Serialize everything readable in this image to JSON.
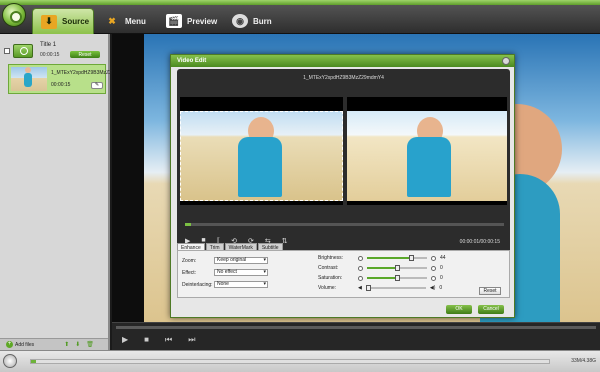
{
  "app": {
    "title_strip": ""
  },
  "tabs": [
    {
      "label": "Source",
      "icon": "source-icon"
    },
    {
      "label": "Menu",
      "icon": "menu-icon"
    },
    {
      "label": "Preview",
      "icon": "preview-icon"
    },
    {
      "label": "Burn",
      "icon": "burn-icon"
    }
  ],
  "sidebar": {
    "title": "Title 1",
    "title_time": "00:00:15",
    "reset_label": "Reset",
    "clip_name": "1_MTExY2xpdHZ9B3MzZ29mdmY4",
    "clip_time": "00:00:15",
    "add_files": "Add files"
  },
  "dialog": {
    "title": "Video Edit",
    "filename": "1_MTExY2xpdHZ9B3MzZ29mdmY4",
    "time": "00:00:01/00:00:15",
    "tabs": [
      {
        "label": "Enhance",
        "active": true
      },
      {
        "label": "Trim"
      },
      {
        "label": "WaterMark"
      },
      {
        "label": "Subtitle"
      }
    ],
    "zoom_label": "Zoom:",
    "zoom_value": "Keep original",
    "effect_label": "Effect:",
    "effect_value": "No effect",
    "deinterlacing_label": "Deinterlacing:",
    "deinterlacing_value": "None",
    "brightness_label": "Brightness:",
    "brightness_value": "44",
    "contrast_label": "Contrast:",
    "contrast_value": "0",
    "saturation_label": "Saturation:",
    "saturation_value": "0",
    "volume_label": "Volume:",
    "volume_value": "0",
    "reset_label": "Reset",
    "ok_label": "OK",
    "cancel_label": "Cancel"
  },
  "status": {
    "capacity": "33M/4.38G"
  }
}
